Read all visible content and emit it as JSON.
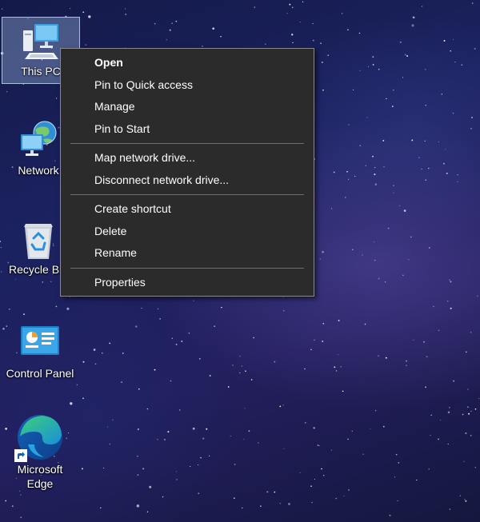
{
  "desktop": {
    "icons": [
      {
        "label": "This PC",
        "icon": "this-pc-icon"
      },
      {
        "label": "Network",
        "icon": "network-icon"
      },
      {
        "label": "Recycle Bin",
        "icon": "recycle-bin-icon"
      },
      {
        "label": "Control Panel",
        "icon": "control-panel-icon"
      },
      {
        "label_line1": "Microsoft",
        "label_line2": "Edge",
        "icon": "edge-icon",
        "shortcut_icon": "shortcut-arrow-icon"
      }
    ]
  },
  "context_menu": {
    "groups": [
      [
        "Open",
        "Pin to Quick access",
        "Manage",
        "Pin to Start"
      ],
      [
        "Map network drive...",
        "Disconnect network drive..."
      ],
      [
        "Create shortcut",
        "Delete",
        "Rename"
      ],
      [
        "Properties"
      ]
    ]
  },
  "colors": {
    "menu_background": "#2b2b2b",
    "menu_border": "#8a8a8a",
    "menu_text": "#ffffff",
    "selection_highlight": "#aac8f0"
  }
}
